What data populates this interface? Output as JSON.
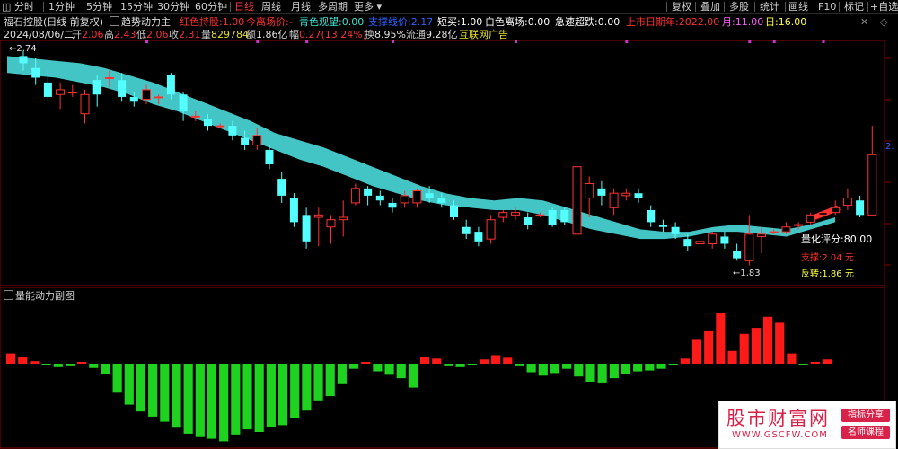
{
  "toolbar": {
    "periods": [
      "分时",
      "1分钟",
      "5分钟",
      "15分钟",
      "30分钟",
      "60分钟",
      "日线",
      "周线",
      "月线",
      "多周期",
      "更多"
    ],
    "active_period": "日线",
    "right_items": [
      "复权",
      "叠加",
      "多股",
      "统计",
      "画线",
      "F10",
      "标记",
      "+自选"
    ]
  },
  "info_line1": {
    "stock_title": "福石控股(日线 前复权)",
    "indicator_name": "趋势动力主",
    "items": [
      {
        "label": "红色持股:",
        "value": "1.00",
        "color": "#ff3030"
      },
      {
        "label": "今离场价:",
        "value": "-",
        "color": "#ff3030"
      },
      {
        "label": "青色观望:",
        "value": "0.00",
        "color": "#40e0d0"
      },
      {
        "label": "支撑线价:",
        "value": "2.17",
        "color": "#3060ff"
      },
      {
        "label": "短买:",
        "value": "1.00",
        "color": "#ffffff"
      },
      {
        "label": "白色离场:",
        "value": "0.00",
        "color": "#ffffff"
      },
      {
        "label": "急速超跌:",
        "value": "0.00",
        "color": "#ffffff"
      },
      {
        "label": "上市日期年:",
        "value": "2022.00",
        "color": "#ff3030"
      },
      {
        "label": "月:",
        "value": "11.00",
        "color": "#ff60ff"
      },
      {
        "label": "日:",
        "value": "16.00",
        "color": "#ffff40"
      }
    ]
  },
  "info_line2": {
    "date": "2024/08/06/二",
    "open_label": "开",
    "open": "2.06",
    "high_label": "高",
    "high": "2.43",
    "low_label": "低",
    "low": "2.06",
    "close_label": "收",
    "close": "2.31",
    "volume_label": "量",
    "volume": "829784",
    "amount_label": "额",
    "amount": "1.86亿",
    "change_label": "幅",
    "change": "0.27(13.24%)",
    "turnover_label": "换",
    "turnover": "8.95%",
    "float_label": "流通",
    "float": "9.28亿",
    "concept": "互联网广告"
  },
  "annotations": {
    "high_marker": "2.74",
    "low_marker": "1.83",
    "score": "量化评分:80.00",
    "support": "支撑:2.04 元",
    "reversal": "反转:1.86 元",
    "right_axis_value": "2."
  },
  "sub_panel": {
    "title": "量能动力副图"
  },
  "watermark": {
    "title": "股市财富网",
    "url": "WWW.GSCFW.COM",
    "tag1": "指标分享",
    "tag2": "名师课程"
  },
  "colors": {
    "up": "#ff3232",
    "down": "#54ffff",
    "band": "#48d0d0",
    "volume_up": "#ff1a1a",
    "volume_down": "#1fd21f",
    "signal_dot": "#cc33cc"
  },
  "chart_data": {
    "type": "candlestick",
    "price_range": [
      1.83,
      2.74
    ],
    "candles": [
      {
        "o": 2.72,
        "c": 2.69,
        "h": 2.74,
        "l": 2.66
      },
      {
        "o": 2.67,
        "c": 2.63,
        "h": 2.71,
        "l": 2.6
      },
      {
        "o": 2.61,
        "c": 2.55,
        "h": 2.66,
        "l": 2.53
      },
      {
        "o": 2.56,
        "c": 2.58,
        "h": 2.61,
        "l": 2.5
      },
      {
        "o": 2.57,
        "c": 2.57,
        "h": 2.6,
        "l": 2.55
      },
      {
        "o": 2.48,
        "c": 2.56,
        "h": 2.58,
        "l": 2.44
      },
      {
        "o": 2.62,
        "c": 2.56,
        "h": 2.64,
        "l": 2.51
      },
      {
        "o": 2.63,
        "c": 2.63,
        "h": 2.66,
        "l": 2.59
      },
      {
        "o": 2.62,
        "c": 2.55,
        "h": 2.65,
        "l": 2.53
      },
      {
        "o": 2.55,
        "c": 2.53,
        "h": 2.57,
        "l": 2.51
      },
      {
        "o": 2.54,
        "c": 2.58,
        "h": 2.6,
        "l": 2.52
      },
      {
        "o": 2.55,
        "c": 2.55,
        "h": 2.56,
        "l": 2.52
      },
      {
        "o": 2.64,
        "c": 2.56,
        "h": 2.65,
        "l": 2.54
      },
      {
        "o": 2.56,
        "c": 2.49,
        "h": 2.57,
        "l": 2.45
      },
      {
        "o": 2.47,
        "c": 2.47,
        "h": 2.49,
        "l": 2.45
      },
      {
        "o": 2.46,
        "c": 2.43,
        "h": 2.48,
        "l": 2.41
      },
      {
        "o": 2.43,
        "c": 2.43,
        "h": 2.44,
        "l": 2.42
      },
      {
        "o": 2.43,
        "c": 2.39,
        "h": 2.45,
        "l": 2.37
      },
      {
        "o": 2.38,
        "c": 2.35,
        "h": 2.41,
        "l": 2.33
      },
      {
        "o": 2.35,
        "c": 2.39,
        "h": 2.42,
        "l": 2.33
      },
      {
        "o": 2.33,
        "c": 2.27,
        "h": 2.35,
        "l": 2.25
      },
      {
        "o": 2.21,
        "c": 2.14,
        "h": 2.24,
        "l": 2.11
      },
      {
        "o": 2.13,
        "c": 2.03,
        "h": 2.15,
        "l": 2.01
      },
      {
        "o": 2.06,
        "c": 1.95,
        "h": 2.09,
        "l": 1.92
      },
      {
        "o": 2.05,
        "c": 2.06,
        "h": 2.09,
        "l": 1.93
      },
      {
        "o": 2.01,
        "c": 2.04,
        "h": 2.06,
        "l": 1.94
      },
      {
        "o": 2.04,
        "c": 2.05,
        "h": 2.12,
        "l": 1.97
      },
      {
        "o": 2.11,
        "c": 2.17,
        "h": 2.19,
        "l": 2.1
      },
      {
        "o": 2.17,
        "c": 2.14,
        "h": 2.18,
        "l": 2.1
      },
      {
        "o": 2.14,
        "c": 2.12,
        "h": 2.16,
        "l": 2.1
      },
      {
        "o": 2.11,
        "c": 2.09,
        "h": 2.13,
        "l": 2.07
      },
      {
        "o": 2.11,
        "c": 2.14,
        "h": 2.16,
        "l": 2.09
      },
      {
        "o": 2.11,
        "c": 2.16,
        "h": 2.17,
        "l": 2.09
      },
      {
        "o": 2.15,
        "c": 2.13,
        "h": 2.18,
        "l": 2.11
      },
      {
        "o": 2.13,
        "c": 2.11,
        "h": 2.15,
        "l": 2.09
      },
      {
        "o": 2.1,
        "c": 2.05,
        "h": 2.12,
        "l": 2.04
      },
      {
        "o": 2.01,
        "c": 1.98,
        "h": 2.04,
        "l": 1.96
      },
      {
        "o": 1.99,
        "c": 1.95,
        "h": 2.01,
        "l": 1.93
      },
      {
        "o": 1.96,
        "c": 2.04,
        "h": 2.06,
        "l": 1.94
      },
      {
        "o": 2.05,
        "c": 2.07,
        "h": 2.08,
        "l": 2.03
      },
      {
        "o": 2.06,
        "c": 2.07,
        "h": 2.09,
        "l": 2.04
      },
      {
        "o": 2.05,
        "c": 2.02,
        "h": 2.07,
        "l": 2.0
      },
      {
        "o": 2.06,
        "c": 2.06,
        "h": 2.07,
        "l": 2.05
      },
      {
        "o": 2.08,
        "c": 2.02,
        "h": 2.09,
        "l": 2.01
      },
      {
        "o": 2.08,
        "c": 2.03,
        "h": 2.09,
        "l": 2.02
      },
      {
        "o": 1.98,
        "c": 2.26,
        "h": 2.29,
        "l": 1.94
      },
      {
        "o": 2.13,
        "c": 2.19,
        "h": 2.22,
        "l": 2.05
      },
      {
        "o": 2.17,
        "c": 2.14,
        "h": 2.2,
        "l": 2.1
      },
      {
        "o": 2.09,
        "c": 2.15,
        "h": 2.17,
        "l": 2.06
      },
      {
        "o": 2.14,
        "c": 2.15,
        "h": 2.17,
        "l": 2.12
      },
      {
        "o": 2.15,
        "c": 2.13,
        "h": 2.17,
        "l": 2.11
      },
      {
        "o": 2.08,
        "c": 2.03,
        "h": 2.1,
        "l": 2.01
      },
      {
        "o": 2.02,
        "c": 2.01,
        "h": 2.04,
        "l": 1.99
      },
      {
        "o": 2.01,
        "c": 1.98,
        "h": 2.03,
        "l": 1.96
      },
      {
        "o": 1.96,
        "c": 1.93,
        "h": 1.98,
        "l": 1.91
      },
      {
        "o": 1.94,
        "c": 1.95,
        "h": 1.97,
        "l": 1.92
      },
      {
        "o": 1.94,
        "c": 1.98,
        "h": 1.99,
        "l": 1.92
      },
      {
        "o": 1.97,
        "c": 1.94,
        "h": 1.99,
        "l": 1.92
      },
      {
        "o": 1.91,
        "c": 1.88,
        "h": 1.94,
        "l": 1.87
      },
      {
        "o": 1.87,
        "c": 1.98,
        "h": 2.06,
        "l": 1.85
      },
      {
        "o": 1.97,
        "c": 1.98,
        "h": 2.01,
        "l": 1.9
      },
      {
        "o": 1.99,
        "c": 1.99,
        "h": 2.0,
        "l": 1.98
      },
      {
        "o": 1.99,
        "c": 2.01,
        "h": 2.03,
        "l": 1.98
      },
      {
        "o": 2.02,
        "c": 2.02,
        "h": 2.03,
        "l": 2.0
      },
      {
        "o": 2.03,
        "c": 2.06,
        "h": 2.07,
        "l": 2.02
      },
      {
        "o": 2.06,
        "c": 2.07,
        "h": 2.1,
        "l": 2.05
      },
      {
        "o": 2.07,
        "c": 2.09,
        "h": 2.12,
        "l": 2.06
      },
      {
        "o": 2.1,
        "c": 2.13,
        "h": 2.17,
        "l": 2.08
      },
      {
        "o": 2.12,
        "c": 2.06,
        "h": 2.14,
        "l": 2.05
      },
      {
        "o": 2.06,
        "c": 2.31,
        "h": 2.43,
        "l": 2.06
      }
    ],
    "band": [
      [
        2.72,
        2.65
      ],
      [
        2.71,
        2.64
      ],
      [
        2.7,
        2.63
      ],
      [
        2.69,
        2.61
      ],
      [
        2.67,
        2.59
      ],
      [
        2.64,
        2.56
      ],
      [
        2.61,
        2.52
      ],
      [
        2.57,
        2.49
      ],
      [
        2.53,
        2.45
      ],
      [
        2.49,
        2.41
      ],
      [
        2.45,
        2.37
      ],
      [
        2.4,
        2.33
      ],
      [
        2.37,
        2.29
      ],
      [
        2.34,
        2.26
      ],
      [
        2.3,
        2.22
      ],
      [
        2.26,
        2.18
      ],
      [
        2.22,
        2.15
      ],
      [
        2.18,
        2.12
      ],
      [
        2.15,
        2.1
      ],
      [
        2.13,
        2.09
      ],
      [
        2.12,
        2.08
      ],
      [
        2.13,
        2.08
      ],
      [
        2.12,
        2.06
      ],
      [
        2.09,
        2.03
      ],
      [
        2.06,
        2.0
      ],
      [
        2.03,
        1.98
      ],
      [
        2.0,
        1.96
      ],
      [
        1.99,
        1.96
      ],
      [
        1.99,
        1.97
      ],
      [
        2.01,
        1.99
      ],
      [
        2.02,
        1.99
      ],
      [
        2.01,
        1.98
      ],
      [
        2.0,
        1.97
      ],
      [
        2.02,
        2.0
      ],
      [
        2.05,
        2.03
      ]
    ],
    "volume_momentum": [
      12,
      8,
      3,
      -2,
      -4,
      -3,
      0,
      -5,
      -12,
      -34,
      -48,
      -56,
      -62,
      -68,
      -75,
      -82,
      -86,
      -88,
      -91,
      -83,
      -77,
      -80,
      -74,
      -72,
      -64,
      -55,
      -43,
      -38,
      -24,
      -6,
      0,
      -9,
      -13,
      -17,
      -28,
      8,
      6,
      -3,
      -4,
      -2,
      5,
      10,
      7,
      -3,
      -10,
      -14,
      -11,
      -6,
      -15,
      -21,
      -22,
      -17,
      -12,
      -9,
      -8,
      -6,
      -2,
      6,
      28,
      38,
      60,
      15,
      35,
      42,
      55,
      48,
      12,
      -1,
      2,
      5
    ],
    "signal_dots": [
      10,
      19,
      23,
      30,
      40,
      49,
      59,
      61,
      65
    ]
  }
}
